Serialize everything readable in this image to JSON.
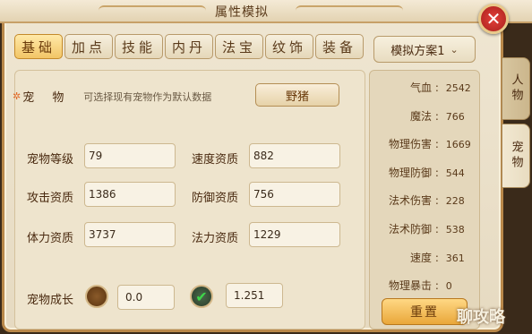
{
  "window": {
    "title": "属性模拟",
    "close_glyph": "✕"
  },
  "tabs": [
    {
      "label": "基础",
      "active": true
    },
    {
      "label": "加点",
      "active": false
    },
    {
      "label": "技能",
      "active": false
    },
    {
      "label": "内丹",
      "active": false
    },
    {
      "label": "法宝",
      "active": false
    },
    {
      "label": "纹饰",
      "active": false
    },
    {
      "label": "装备",
      "active": false
    }
  ],
  "scheme": {
    "selected": "模拟方案1"
  },
  "pet": {
    "label": "宠 物",
    "hint": "可选择现有宠物作为默认数据",
    "button_label": "野猪"
  },
  "fields": {
    "pet_level": {
      "label": "宠物等级",
      "value": "79"
    },
    "speed_apt": {
      "label": "速度资质",
      "value": "882"
    },
    "attack_apt": {
      "label": "攻击资质",
      "value": "1386"
    },
    "defense_apt": {
      "label": "防御资质",
      "value": "756"
    },
    "hp_apt": {
      "label": "体力资质",
      "value": "3737"
    },
    "mana_apt": {
      "label": "法力资质",
      "value": "1229"
    },
    "growth": {
      "label": "宠物成长",
      "value_left": "0.0",
      "value_right": "1.251"
    }
  },
  "stats": [
    {
      "name": "气血",
      "value": "2542"
    },
    {
      "name": "魔法",
      "value": "766"
    },
    {
      "name": "物理伤害",
      "value": "1669"
    },
    {
      "name": "物理防御",
      "value": "544"
    },
    {
      "name": "法术伤害",
      "value": "228"
    },
    {
      "name": "法术防御",
      "value": "538"
    },
    {
      "name": "速度",
      "value": "361"
    },
    {
      "name": "物理暴击",
      "value": "0"
    }
  ],
  "reset_label": "重置",
  "side_tabs": [
    {
      "label": "人物",
      "active": false
    },
    {
      "label": "宠物",
      "active": true
    }
  ],
  "watermark": "聊攻略",
  "check_glyph": "✔",
  "chevron_glyph": "⌄"
}
